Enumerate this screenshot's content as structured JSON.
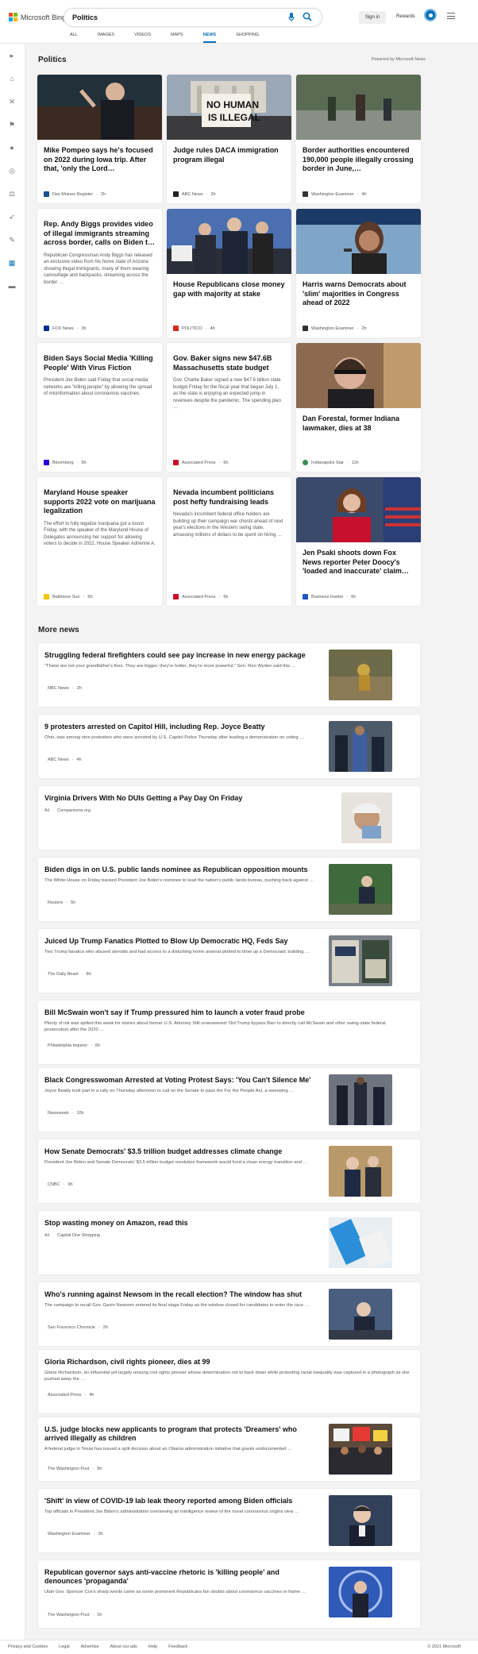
{
  "header": {
    "logo_text": "Microsoft Bing",
    "search_query": "Politics",
    "signin_label": "Sign in",
    "rewards_label": "Rewards",
    "tabs": [
      "ALL",
      "IMAGES",
      "VIDEOS",
      "MAPS",
      "NEWS",
      "SHOPPING"
    ],
    "active_tab": "NEWS"
  },
  "colors": {
    "accent": "#0a70b8",
    "page_bg": "#f3f3f3"
  },
  "rail_icons": [
    "chevron-right-icon",
    "home-icon",
    "tools-icon",
    "flag-icon",
    "globe-icon",
    "bank-icon",
    "scales-icon",
    "rocket-icon",
    "movie-icon",
    "cards-icon",
    "wallet-icon"
  ],
  "politics": {
    "title": "Politics",
    "powered": "Powered by Microsoft News",
    "cards": [
      {
        "headline": "Mike Pompeo says he's focused on 2022 during Iowa trip. After that, 'only the Lord…",
        "source": "Des Moines Register",
        "time": "2h"
      },
      {
        "headline": "Judge rules DACA immigration program illegal",
        "source": "ABC News",
        "time": "2h"
      },
      {
        "headline": "Border authorities encountered 190,000 people illegally crossing border in June,…",
        "source": "Washington Examiner",
        "time": "4h"
      },
      {
        "headline": "Rep. Andy Biggs provides video of illegal immigrants streaming across border, calls on Biden t…",
        "summary": "Republican Congressman Andy Biggs has released an exclusive video from his home state of Arizona showing illegal immigrants, many of them wearing camouflage and backpacks, streaming across the border …",
        "source": "FOX News",
        "time": "3h"
      },
      {
        "headline": "House Republicans close money gap with majority at stake",
        "source": "POLITICO",
        "time": "4h"
      },
      {
        "headline": "Harris warns Democrats about 'slim' majorities in Congress ahead of 2022",
        "source": "Washington Examiner",
        "time": "2h"
      },
      {
        "headline": "Biden Says Social Media 'Killing People' With Virus Fiction",
        "summary": "President Joe Biden said Friday that social media networks are \"killing people\" by allowing the spread of misinformation about coronavirus vaccines.",
        "source": "Bloomberg",
        "time": "5h"
      },
      {
        "headline": "Gov. Baker signs new $47.6B Massachusetts state budget",
        "summary": "Gov. Charlie Baker signed a new $47.6 billion state budget Friday for the fiscal year that began July 1, as the state is enjoying an expected jump in revenues despite the pandemic. The spending plan …",
        "source": "Associated Press",
        "time": "6h"
      },
      {
        "headline": "Dan Forestal, former Indiana lawmaker, dies at 38",
        "source": "Indianapolis Star",
        "time": "11h"
      },
      {
        "headline": "Maryland House speaker supports 2022 vote on marijuana legalization",
        "summary": "The effort to fully legalize marijuana got a boost Friday, with the speaker of the Maryland House of Delegates announcing her support for allowing voters to decide in 2022. House Speaker Adrienne A.",
        "source": "Baltimore Sun",
        "time": "5h"
      },
      {
        "headline": "Nevada incumbent politicians post hefty fundraising leads",
        "summary": "Nevada's incumbent federal office holders are building up their campaign war chests ahead of next year's elections in the Western swing state, amassing millions of dollars to be spent on hiring …",
        "source": "Associated Press",
        "time": "6h"
      },
      {
        "headline": "Jen Psaki shoots down Fox News reporter Peter Doocy's 'loaded and inaccurate' claim…",
        "source": "Business Insider",
        "time": "6h"
      }
    ]
  },
  "more_news": {
    "title": "More news",
    "items": [
      {
        "headline": "Struggling federal firefighters could see pay increase in new energy package",
        "summary": "\"These are not your grandfather's fires. They are bigger, they're hotter, they're more powerful,\" Sen. Ron Wyden said this …",
        "source": "NBC News",
        "time": "2h"
      },
      {
        "headline": "9 protesters arrested on Capitol Hill, including Rep. Joyce Beatty",
        "summary": "Ohio, was among nine protesters who were arrested by U.S. Capitol Police Thursday after leading a demonstration on voting …",
        "source": "ABC News",
        "time": "4h"
      },
      {
        "headline": "Virginia Drivers With No DUIs Getting a Pay Day On Friday",
        "ad": "Ad",
        "source": "Comparisons.org"
      },
      {
        "headline": "Biden digs in on U.S. public lands nominee as Republican opposition mounts",
        "summary": "The White House on Friday backed President Joe Biden's nominee to lead the nation's public lands bureau, pushing back against …",
        "source": "Reuters",
        "time": "5h"
      },
      {
        "headline": "Juiced Up Trump Fanatics Plotted to Blow Up Democratic HQ, Feds Say",
        "summary": "Two Trump fanatics who abused steroids and had access to a disturbing home arsenal plotted to blow up a Democratic building …",
        "source": "The Daily Beast",
        "time": "8h"
      },
      {
        "headline": "Bill McSwain won't say if Trump pressured him to launch a voter fraud probe",
        "summary": "Plenty of ink was spilled this week for stories about former U.S. Attorney Still unanswered: Did Trump bypass Barr to directly call McSwain and other swing-state federal prosecutors after the 2020 …",
        "source": "Philadelphia Inquirer",
        "time": "6h"
      },
      {
        "headline": "Black Congresswoman Arrested at Voting Protest Says: 'You Can't Silence Me'",
        "summary": "Joyce Beatty took part in a rally on Thursday afternoon to call on the Senate to pass the For the People Act, a sweeping …",
        "source": "Newsweek",
        "time": "10h"
      },
      {
        "headline": "How Senate Democrats' $3.5 trillion budget addresses climate change",
        "summary": "President Joe Biden and Senate Democrats' $3.5 trillion budget resolution framework would fund a clean energy transition and …",
        "source": "CNBC",
        "time": "9h"
      },
      {
        "headline": "Stop wasting money on Amazon, read this",
        "ad": "Ad",
        "source": "Capital One Shopping"
      },
      {
        "headline": "Who's running against Newsom in the recall election? The window has shut",
        "summary": "The campaign to recall Gov. Gavin Newsom entered its final stage Friday as the window closed for candidates to enter the race …",
        "source": "San Francisco Chronicle",
        "time": "2h"
      },
      {
        "headline": "Gloria Richardson, civil rights pioneer, dies at 99",
        "summary": "Gloria Richardson, an influential yet largely unsung civil rights pioneer whose determination not to back down while protesting racial inequality was captured in a photograph as she pushed away the …",
        "source": "Associated Press",
        "time": "4h"
      },
      {
        "headline": "U.S. judge blocks new applicants to program that protects 'Dreamers' who arrived illegally as children",
        "summary": "A federal judge in Texas has issued a split decision about an Obama administration initiative that grants undocumented …",
        "source": "The Washington Post",
        "time": "5h"
      },
      {
        "headline": "'Shift' in view of COVID-19 lab leak theory reported among Biden officials",
        "summary": "Top officials in President Joe Biden's administration overseeing an intelligence review of the novel coronavirus origins view …",
        "source": "Washington Examiner",
        "time": "3h"
      },
      {
        "headline": "Republican governor says anti-vaccine rhetoric is 'killing people' and denounces 'propaganda'",
        "summary": "Utah Gov. Spencer Cox's sharp words came as some prominent Republicans fan doubts about coronavirus vaccines or frame …",
        "source": "The Washington Post",
        "time": "1h"
      }
    ]
  },
  "footer": {
    "links": [
      "Privacy and Cookies",
      "Legal",
      "Advertise",
      "About our ads",
      "Help",
      "Feedback"
    ],
    "copyright": "© 2021 Microsoft"
  }
}
